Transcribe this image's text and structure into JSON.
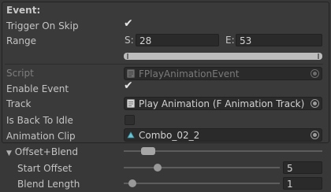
{
  "header": {
    "title": "Event:"
  },
  "fields": {
    "trigger_on_skip": {
      "label": "Trigger On Skip",
      "checked": true
    },
    "range": {
      "label": "Range",
      "start_label": "S:",
      "start_value": "28",
      "end_label": "E:",
      "end_value": "53"
    },
    "script": {
      "label": "Script",
      "value": "FPlayAnimationEvent"
    },
    "enable_event": {
      "label": "Enable Event",
      "checked": true
    },
    "track": {
      "label": "Track",
      "value": "Play Animation (F Animation Track)"
    },
    "is_back_to_idle": {
      "label": "Is Back To Idle",
      "checked": false
    },
    "animation_clip": {
      "label": "Animation Clip",
      "value": "Combo_02_2"
    },
    "offset_blend": {
      "label": "Offset+Blend",
      "expanded": true
    },
    "start_offset": {
      "label": "Start Offset",
      "value": "5",
      "slider_fraction": 0.2
    },
    "blend_length": {
      "label": "Blend Length",
      "value": "1",
      "slider_fraction": 0.03
    }
  },
  "icons": {
    "script": "script-file-icon",
    "track": "track-asset-icon",
    "clip": "animation-clip-icon",
    "picker": "object-picker-icon",
    "foldout": "foldout-arrow-icon"
  },
  "colors": {
    "background": "#383838",
    "field": "#2a2a2a",
    "text": "#c4c4c4"
  }
}
